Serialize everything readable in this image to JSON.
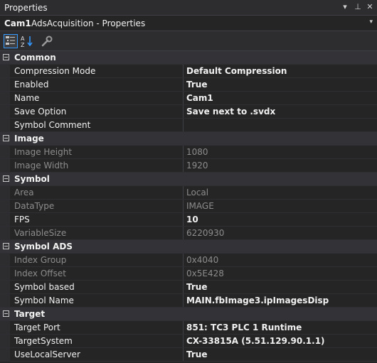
{
  "window": {
    "title": "Properties",
    "buttons": {
      "dropdown": "▾",
      "pin": "⊥",
      "close": "✕"
    }
  },
  "object_selector": {
    "name": "Cam1",
    "type": "AdsAcquisition - Properties",
    "dropdown": "▾"
  },
  "toolbar": {
    "buttons": [
      {
        "icon": "categorized-icon",
        "active": true
      },
      {
        "icon": "alphabetical-sort-icon",
        "active": false
      },
      {
        "icon": "property-pages-wrench-icon",
        "active": false
      }
    ]
  },
  "categories": [
    {
      "name": "Common",
      "properties": [
        {
          "name": "Compression Mode",
          "value": "Default Compression",
          "readonly": false,
          "bold": true
        },
        {
          "name": "Enabled",
          "value": "True",
          "readonly": false,
          "bold": true
        },
        {
          "name": "Name",
          "value": "Cam1",
          "readonly": false,
          "bold": true
        },
        {
          "name": "Save Option",
          "value": "Save next to .svdx",
          "readonly": false,
          "bold": true
        },
        {
          "name": "Symbol Comment",
          "value": "",
          "readonly": false,
          "bold": false
        }
      ]
    },
    {
      "name": "Image",
      "properties": [
        {
          "name": "Image Height",
          "value": "1080",
          "readonly": true,
          "bold": false
        },
        {
          "name": "Image Width",
          "value": "1920",
          "readonly": true,
          "bold": false
        }
      ]
    },
    {
      "name": "Symbol",
      "properties": [
        {
          "name": "Area",
          "value": "Local",
          "readonly": true,
          "bold": false
        },
        {
          "name": "DataType",
          "value": "IMAGE",
          "readonly": true,
          "bold": false
        },
        {
          "name": "FPS",
          "value": "10",
          "readonly": false,
          "bold": true
        },
        {
          "name": "VariableSize",
          "value": "6220930",
          "readonly": true,
          "bold": false
        }
      ]
    },
    {
      "name": "Symbol ADS",
      "properties": [
        {
          "name": "Index Group",
          "value": "0x4040",
          "readonly": true,
          "bold": false
        },
        {
          "name": "Index Offset",
          "value": "0x5E428",
          "readonly": true,
          "bold": false
        },
        {
          "name": "Symbol based",
          "value": "True",
          "readonly": false,
          "bold": true
        },
        {
          "name": "Symbol Name",
          "value": "MAIN.fbImage3.ipImagesDisp",
          "readonly": false,
          "bold": true
        }
      ]
    },
    {
      "name": "Target",
      "properties": [
        {
          "name": "Target Port",
          "value": "851: TC3 PLC 1 Runtime",
          "readonly": false,
          "bold": true
        },
        {
          "name": "TargetSystem",
          "value": "CX-33815A (5.51.129.90.1.1)",
          "readonly": false,
          "bold": true
        },
        {
          "name": "UseLocalServer",
          "value": "True",
          "readonly": false,
          "bold": true
        }
      ]
    }
  ]
}
